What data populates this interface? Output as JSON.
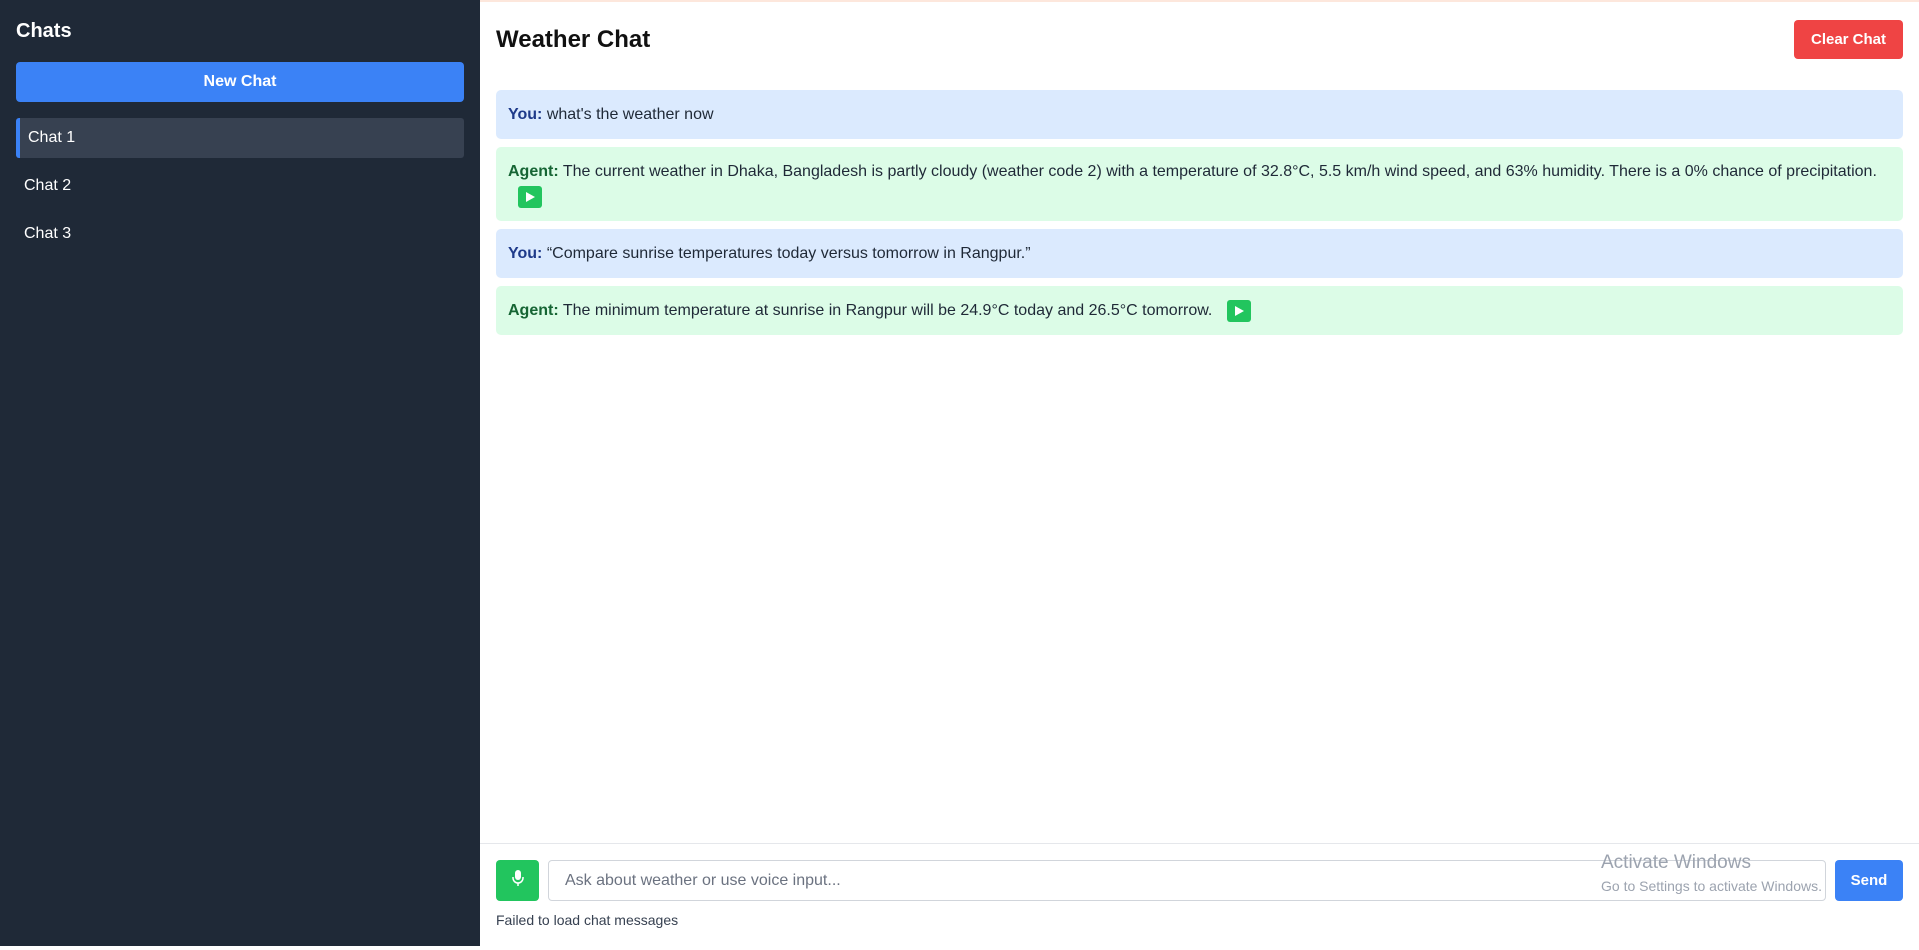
{
  "sidebar": {
    "title": "Chats",
    "new_chat_label": "New Chat",
    "items": [
      {
        "label": "Chat 1",
        "active": true
      },
      {
        "label": "Chat 2",
        "active": false
      },
      {
        "label": "Chat 3",
        "active": false
      }
    ]
  },
  "header": {
    "title": "Weather Chat",
    "clear_label": "Clear Chat"
  },
  "messages": [
    {
      "role": "user",
      "speaker": "You:",
      "text": "what's the weather now"
    },
    {
      "role": "agent",
      "speaker": "Agent:",
      "text": "The current weather in Dhaka, Bangladesh is partly cloudy (weather code 2) with a temperature of 32.8°C, 5.5 km/h wind speed, and 63% humidity. There is a 0% chance of precipitation."
    },
    {
      "role": "user",
      "speaker": "You:",
      "text": "“Compare sunrise temperatures today versus tomorrow in Rangpur.”"
    },
    {
      "role": "agent",
      "speaker": "Agent:",
      "text": "The minimum temperature at sunrise in Rangpur will be 24.9°C today and 26.5°C tomorrow."
    }
  ],
  "composer": {
    "placeholder": "Ask about weather or use voice input...",
    "value": "",
    "send_label": "Send",
    "status": "Failed to load chat messages"
  },
  "watermark": {
    "title": "Activate Windows",
    "subtitle": "Go to Settings to activate Windows."
  },
  "icons": {
    "play": "play-icon",
    "mic": "microphone-icon"
  },
  "colors": {
    "sidebar_bg": "#1f2937",
    "primary": "#3b82f6",
    "danger": "#ef4444",
    "success": "#22c55e",
    "user_bubble": "#dbeafe",
    "agent_bubble": "#dcfce7"
  }
}
